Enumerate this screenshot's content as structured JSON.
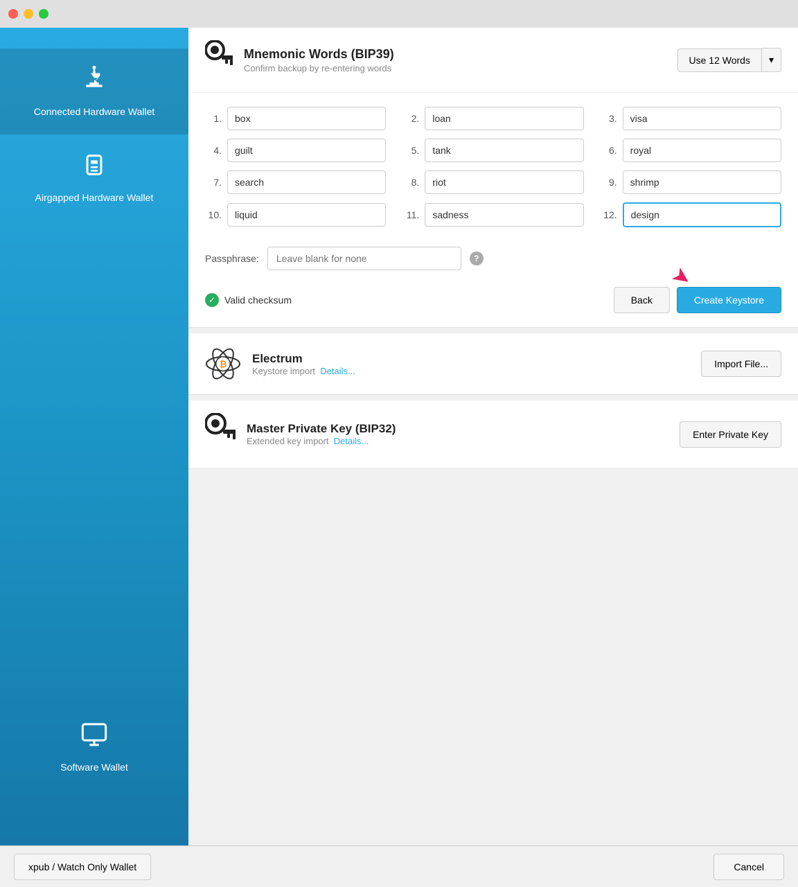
{
  "titlebar": {
    "close": "close",
    "minimize": "minimize",
    "maximize": "maximize"
  },
  "sidebar": {
    "items": [
      {
        "id": "connected-hardware-wallet",
        "label": "Connected Hardware Wallet",
        "icon": "usb"
      },
      {
        "id": "airgapped-hardware-wallet",
        "label": "Airgapped Hardware Wallet",
        "icon": "sd-card"
      },
      {
        "id": "software-wallet",
        "label": "Software Wallet",
        "icon": "monitor"
      }
    ]
  },
  "mnemonic": {
    "title": "Mnemonic Words (BIP39)",
    "subtitle": "Confirm backup by re-entering words",
    "use_words_label": "Use 12 Words",
    "words": [
      {
        "num": "1.",
        "value": "box"
      },
      {
        "num": "2.",
        "value": "loan"
      },
      {
        "num": "3.",
        "value": "visa"
      },
      {
        "num": "4.",
        "value": "guilt"
      },
      {
        "num": "5.",
        "value": "tank"
      },
      {
        "num": "6.",
        "value": "royal"
      },
      {
        "num": "7.",
        "value": "search"
      },
      {
        "num": "8.",
        "value": "riot"
      },
      {
        "num": "9.",
        "value": "shrimp"
      },
      {
        "num": "10.",
        "value": "liquid"
      },
      {
        "num": "11.",
        "value": "sadness"
      },
      {
        "num": "12.",
        "value": "design"
      }
    ],
    "passphrase_label": "Passphrase:",
    "passphrase_placeholder": "Leave blank for none",
    "checksum_label": "Valid checksum",
    "back_btn": "Back",
    "create_keystore_btn": "Create Keystore"
  },
  "electrum": {
    "title": "Electrum",
    "subtitle": "Keystore import",
    "details_link": "Details...",
    "import_file_btn": "Import File..."
  },
  "master_private_key": {
    "title": "Master Private Key (BIP32)",
    "subtitle": "Extended key import",
    "details_link": "Details...",
    "enter_key_btn": "Enter Private Key"
  },
  "bottom_bar": {
    "xpub_btn": "xpub / Watch Only Wallet",
    "cancel_btn": "Cancel"
  }
}
